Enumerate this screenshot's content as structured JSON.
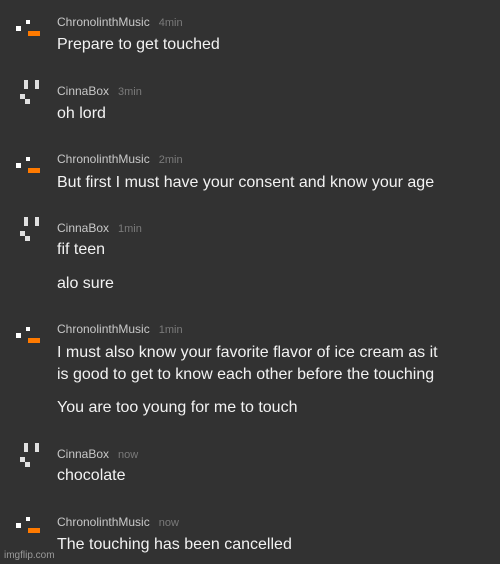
{
  "messages": [
    {
      "author": "ChronolinthMusic",
      "time": "4min",
      "lines": [
        "Prepare to get touched"
      ]
    },
    {
      "author": "CinnaBox",
      "time": "3min",
      "lines": [
        "oh lord"
      ]
    },
    {
      "author": "ChronolinthMusic",
      "time": "2min",
      "lines": [
        "But first I must have your consent and know your age"
      ]
    },
    {
      "author": "CinnaBox",
      "time": "1min",
      "lines": [
        "fif teen",
        "alo sure"
      ]
    },
    {
      "author": "ChronolinthMusic",
      "time": "1min",
      "lines": [
        "I must also know your favorite flavor of ice cream as it",
        "is good to get to know each other before the touching",
        "You are too young for me to touch"
      ]
    },
    {
      "author": "CinnaBox",
      "time": "now",
      "lines": [
        "chocolate"
      ]
    },
    {
      "author": "ChronolinthMusic",
      "time": "now",
      "lines": [
        "The touching has been cancelled"
      ]
    }
  ],
  "avatars": {
    "chronolinth_accent": "#ff7a00",
    "chronolinth_dot": "#ffffff",
    "cinna_color": "#e0e0e0"
  },
  "watermark": "imgflip.com"
}
